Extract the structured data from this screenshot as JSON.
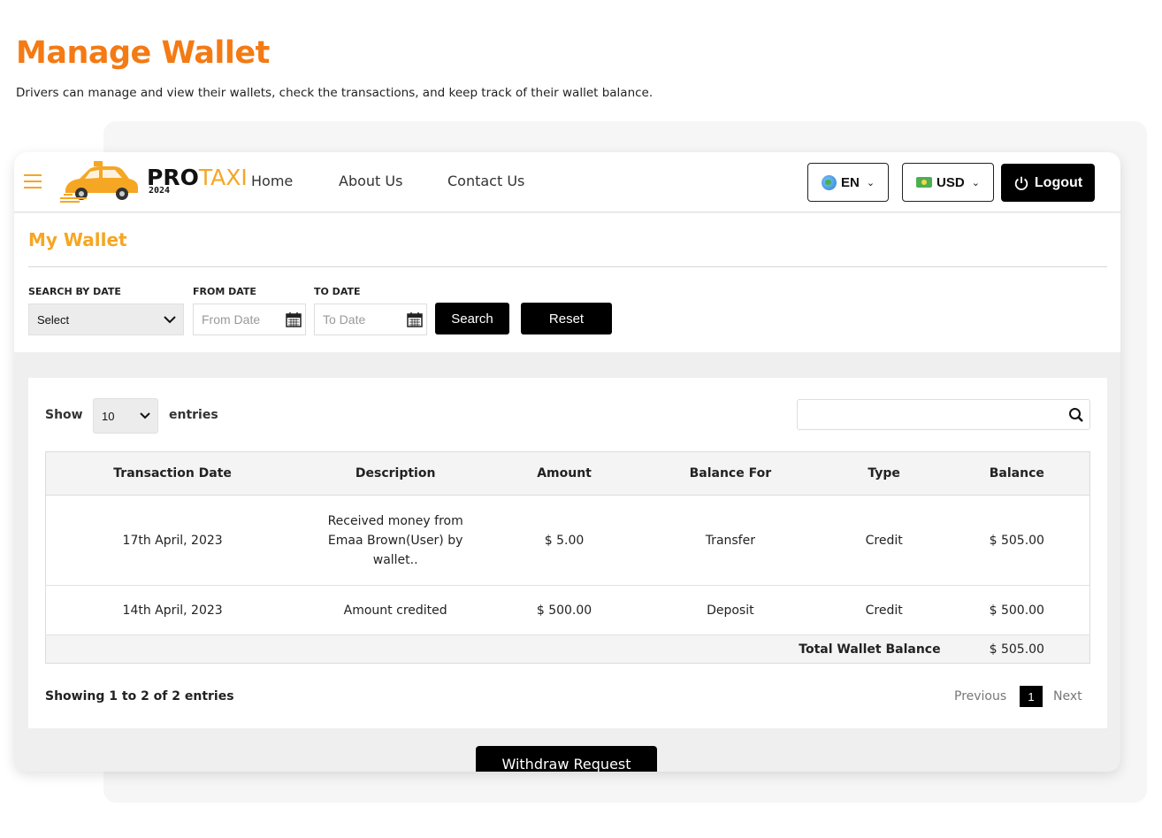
{
  "page": {
    "heading": "Manage Wallet",
    "subheading": "Drivers can manage and view their wallets, check the transactions, and keep track of their wallet balance."
  },
  "header": {
    "logo_pro": "PRO",
    "logo_taxi": "TAXI",
    "logo_year": "2024",
    "nav": [
      "Home",
      "About Us",
      "Contact Us"
    ],
    "language": "EN",
    "currency": "USD",
    "logout": "Logout"
  },
  "filters": {
    "title": "My Wallet",
    "search_by_date_label": "SEARCH BY DATE",
    "search_by_date_value": "Select",
    "from_date_label": "FROM DATE",
    "from_date_placeholder": "From Date",
    "to_date_label": "TO DATE",
    "to_date_placeholder": "To Date",
    "search_button": "Search",
    "reset_button": "Reset"
  },
  "table_controls": {
    "show_label": "Show",
    "entries_value": "10",
    "entries_label": "entries"
  },
  "table": {
    "columns": [
      "Transaction Date",
      "Description",
      "Amount",
      "Balance For",
      "Type",
      "Balance"
    ],
    "rows": [
      [
        "17th April, 2023",
        "Received money from Emaa Brown(User) by wallet..",
        "$ 5.00",
        "Transfer",
        "Credit",
        "$ 505.00"
      ],
      [
        "14th April, 2023",
        "Amount credited",
        "$ 500.00",
        "Deposit",
        "Credit",
        "$ 500.00"
      ]
    ],
    "total_label": "Total Wallet Balance",
    "total_value": "$ 505.00"
  },
  "footer": {
    "showing": "Showing 1 to 2 of 2 entries",
    "previous": "Previous",
    "current_page": "1",
    "next": "Next",
    "withdraw_button": "Withdraw Request"
  },
  "colors": {
    "heading_orange": "#f47a14",
    "accent_orange": "#f5a623",
    "button_black": "#000000"
  },
  "icons": [
    "hamburger-icon",
    "taxi-logo-icon",
    "globe-icon",
    "money-icon",
    "chevron-down-icon",
    "power-icon",
    "calendar-icon",
    "search-icon"
  ]
}
